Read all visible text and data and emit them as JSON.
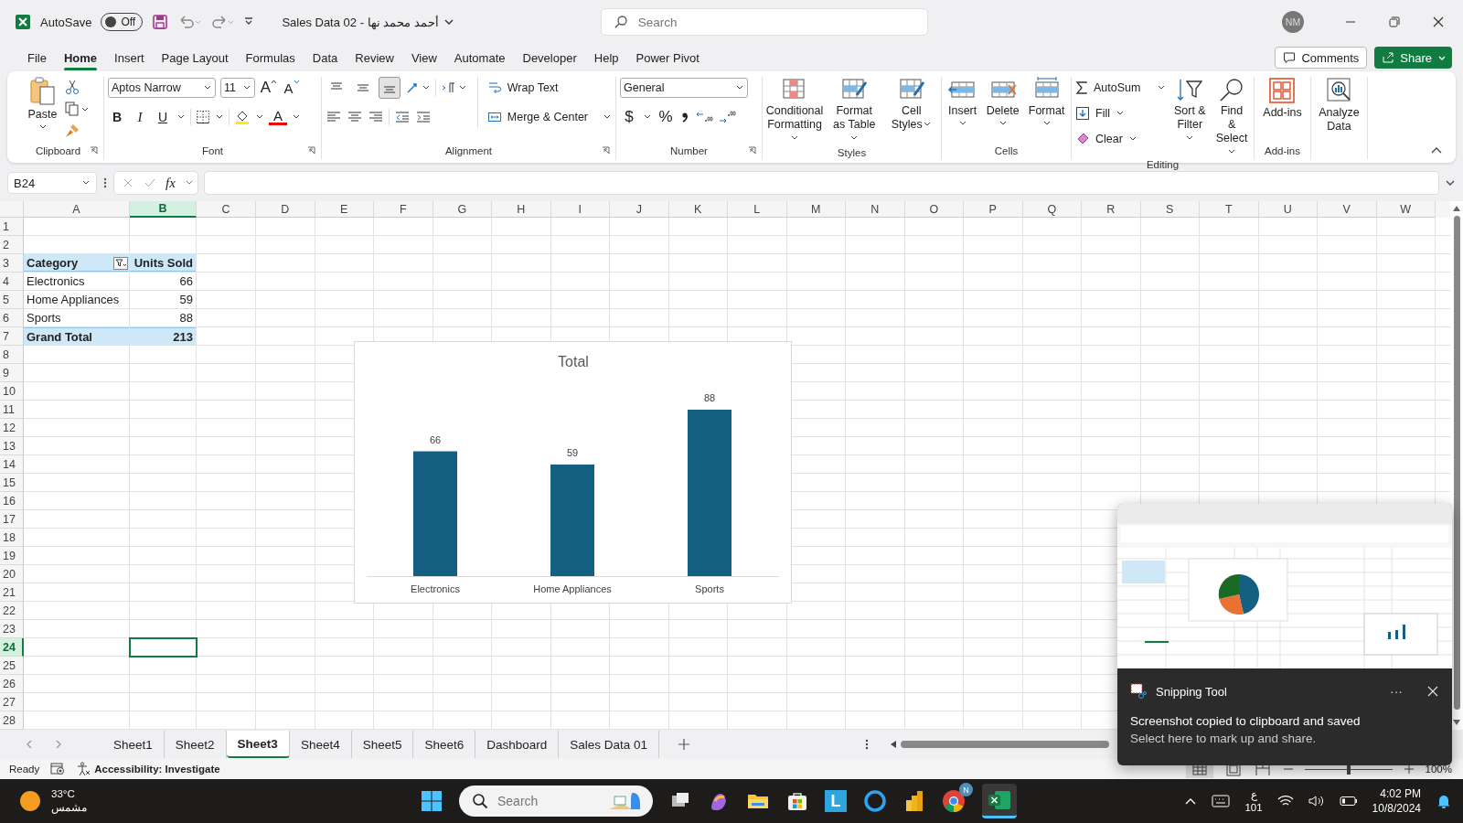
{
  "title_bar": {
    "autosave": {
      "label": "AutoSave",
      "on": false,
      "state": "Off"
    },
    "document_title": "Sales Data 02 - أحمد محمد نها",
    "search": {
      "placeholder": "Search"
    },
    "user_initials": "NM"
  },
  "menu_tabs": [
    {
      "label": "File",
      "selected": false
    },
    {
      "label": "Home",
      "selected": true
    },
    {
      "label": "Insert",
      "selected": false
    },
    {
      "label": "Page Layout",
      "selected": false
    },
    {
      "label": "Formulas",
      "selected": false
    },
    {
      "label": "Data",
      "selected": false
    },
    {
      "label": "Review",
      "selected": false
    },
    {
      "label": "View",
      "selected": false
    },
    {
      "label": "Automate",
      "selected": false
    },
    {
      "label": "Developer",
      "selected": false
    },
    {
      "label": "Help",
      "selected": false
    },
    {
      "label": "Power Pivot",
      "selected": false
    }
  ],
  "comments_button": "Comments",
  "share_button": "Share",
  "ribbon": {
    "clipboard": {
      "name": "Clipboard",
      "paste": "Paste"
    },
    "font": {
      "name": "Font",
      "font_name": "Aptos Narrow",
      "font_size": "11",
      "grow_font": "A",
      "shrink_font": "A",
      "bold": "B",
      "italic": "I",
      "underline": "U",
      "font_color": "A"
    },
    "alignment": {
      "name": "Alignment",
      "vertical_align": [
        {
          "selected": false
        },
        {
          "selected": false
        },
        {
          "selected": true
        }
      ],
      "wrap_text": "Wrap Text",
      "merge_center": "Merge & Center"
    },
    "number": {
      "name": "Number",
      "format": "General",
      "currency": "$",
      "percent": "%"
    },
    "styles": {
      "name": "Styles",
      "buttons": [
        "Conditional Formatting",
        "Format as Table",
        "Cell Styles"
      ]
    },
    "cells": {
      "name": "Cells",
      "buttons": [
        "Insert",
        "Delete",
        "Format"
      ]
    },
    "editing": {
      "name": "Editing",
      "autosum": "AutoSum",
      "fill": "Fill",
      "clear": "Clear",
      "sort_filter": "Sort & Filter",
      "find_select": "Find & Select"
    },
    "addins": {
      "name": "Add-ins",
      "button": "Add-ins"
    },
    "analyze_data": "Analyze Data"
  },
  "formula_bar": {
    "name_box": "B24",
    "function_label": "fx"
  },
  "sheet": {
    "columns": [
      {
        "label": "A",
        "selected": false
      },
      {
        "label": "B",
        "selected": true
      },
      {
        "label": "C",
        "selected": false
      },
      {
        "label": "D",
        "selected": false
      },
      {
        "label": "E",
        "selected": false
      },
      {
        "label": "F",
        "selected": false
      },
      {
        "label": "G",
        "selected": false
      },
      {
        "label": "H",
        "selected": false
      },
      {
        "label": "I",
        "selected": false
      },
      {
        "label": "J",
        "selected": false
      },
      {
        "label": "K",
        "selected": false
      },
      {
        "label": "L",
        "selected": false
      },
      {
        "label": "M",
        "selected": false
      },
      {
        "label": "N",
        "selected": false
      },
      {
        "label": "O",
        "selected": false
      },
      {
        "label": "P",
        "selected": false
      },
      {
        "label": "Q",
        "selected": false
      },
      {
        "label": "R",
        "selected": false
      },
      {
        "label": "S",
        "selected": false
      },
      {
        "label": "T",
        "selected": false
      },
      {
        "label": "U",
        "selected": false
      },
      {
        "label": "V",
        "selected": false
      },
      {
        "label": "W",
        "selected": false
      }
    ],
    "rows": [
      {
        "label": "1",
        "selected": false,
        "kind": "blank"
      },
      {
        "label": "2",
        "selected": false,
        "kind": "blank"
      },
      {
        "label": "3",
        "selected": false,
        "kind": "pivot_header",
        "cells": [
          "Category",
          "Units Sold"
        ]
      },
      {
        "label": "4",
        "selected": false,
        "kind": "pivot_item",
        "cells": [
          "Electronics",
          "66"
        ]
      },
      {
        "label": "5",
        "selected": false,
        "kind": "pivot_item",
        "cells": [
          "Home Appliances",
          "59"
        ]
      },
      {
        "label": "6",
        "selected": false,
        "kind": "pivot_item",
        "cells": [
          "Sports",
          "88"
        ]
      },
      {
        "label": "7",
        "selected": false,
        "kind": "pivot_total",
        "cells": [
          "Grand Total",
          "213"
        ]
      },
      {
        "label": "8",
        "selected": false,
        "kind": "blank"
      },
      {
        "label": "9",
        "selected": false,
        "kind": "blank"
      },
      {
        "label": "10",
        "selected": false,
        "kind": "blank"
      },
      {
        "label": "11",
        "selected": false,
        "kind": "blank"
      },
      {
        "label": "12",
        "selected": false,
        "kind": "blank"
      },
      {
        "label": "13",
        "selected": false,
        "kind": "blank"
      },
      {
        "label": "14",
        "selected": false,
        "kind": "blank"
      },
      {
        "label": "15",
        "selected": false,
        "kind": "blank"
      },
      {
        "label": "16",
        "selected": false,
        "kind": "blank"
      },
      {
        "label": "17",
        "selected": false,
        "kind": "blank"
      },
      {
        "label": "18",
        "selected": false,
        "kind": "blank"
      },
      {
        "label": "19",
        "selected": false,
        "kind": "blank"
      },
      {
        "label": "20",
        "selected": false,
        "kind": "blank"
      },
      {
        "label": "21",
        "selected": false,
        "kind": "blank"
      },
      {
        "label": "22",
        "selected": false,
        "kind": "blank"
      },
      {
        "label": "23",
        "selected": false,
        "kind": "blank"
      },
      {
        "label": "24",
        "selected": true,
        "kind": "blank"
      },
      {
        "label": "25",
        "selected": false,
        "kind": "blank"
      },
      {
        "label": "26",
        "selected": false,
        "kind": "blank"
      },
      {
        "label": "27",
        "selected": false,
        "kind": "blank"
      },
      {
        "label": "28",
        "selected": false,
        "kind": "blank"
      }
    ]
  },
  "chart": {
    "chart_data": {
      "type": "bar",
      "title": "Total",
      "categories": [
        "Electronics",
        "Home Appliances",
        "Sports"
      ],
      "series": [
        {
          "color": "#156082",
          "values": [
            66,
            59,
            88
          ]
        }
      ],
      "data_labels": true
    }
  },
  "sheet_tabs": [
    {
      "label": "Sheet1",
      "selected": false
    },
    {
      "label": "Sheet2",
      "selected": false
    },
    {
      "label": "Sheet3",
      "selected": true
    },
    {
      "label": "Sheet4",
      "selected": false
    },
    {
      "label": "Sheet5",
      "selected": false
    },
    {
      "label": "Sheet6",
      "selected": false
    },
    {
      "label": "Dashboard",
      "selected": false
    },
    {
      "label": "Sales Data 01",
      "selected": false
    }
  ],
  "status_bar": {
    "status": "Ready",
    "accessibility": "Accessibility: Investigate",
    "zoom": "100%",
    "zoom_slider": {
      "level": 0.5
    }
  },
  "taskbar": {
    "weather": {
      "temperature": "33°C",
      "condition": "مشمس"
    },
    "search": {
      "placeholder": "Search"
    },
    "app_letter": "L",
    "badge": "N",
    "keyboard_layout": {
      "language": "ع",
      "code": "101"
    },
    "time": "4:02 PM",
    "date": "10/8/2024"
  },
  "notification": {
    "app": "Snipping Tool",
    "more": "···",
    "title": "Screenshot copied to clipboard and saved",
    "body": "Select here to mark up and share."
  }
}
